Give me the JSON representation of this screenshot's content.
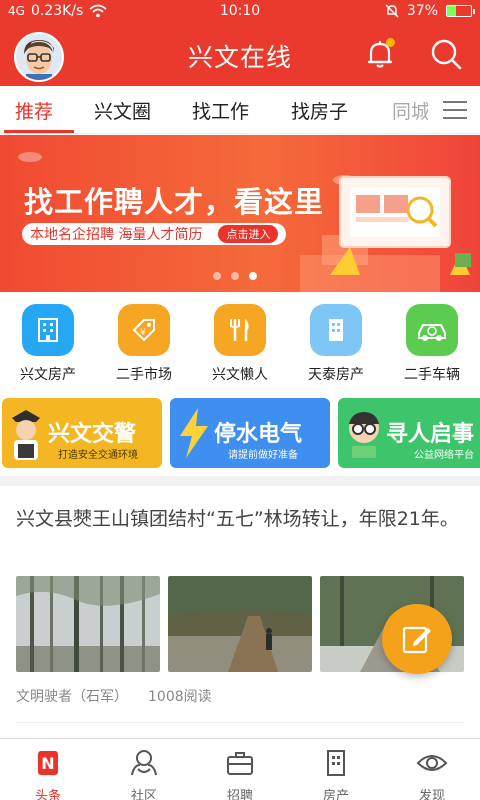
{
  "status": {
    "network": "4G",
    "speed": "0.23K/s",
    "time": "10:10",
    "battery": "37%",
    "battery_level": 0.37
  },
  "header": {
    "title": "兴文在线",
    "avatar_icon": "avatar-cartoon-glasses",
    "notification_icon": "bell-icon",
    "search_icon": "search-icon"
  },
  "tabs": [
    {
      "label": "推荐",
      "active": true
    },
    {
      "label": "兴文圈"
    },
    {
      "label": "找工作"
    },
    {
      "label": "找房子"
    },
    {
      "label": "同城"
    }
  ],
  "banner": {
    "headline": "找工作聘人才，看这里",
    "subtext": "本地名企招聘  海量人才简历",
    "cta": "点击进入",
    "slide_count": 3,
    "active_slide": 3
  },
  "quick_links": [
    {
      "label": "兴文房产",
      "icon": "building-icon",
      "color": "#25a7f3"
    },
    {
      "label": "二手市场",
      "icon": "price-tag-icon",
      "color": "#f6a623"
    },
    {
      "label": "兴文懒人",
      "icon": "fork-knife-icon",
      "color": "#f6a623"
    },
    {
      "label": "天泰房产",
      "icon": "building-icon",
      "color": "#7ec6f6"
    },
    {
      "label": "二手车辆",
      "icon": "car-icon",
      "color": "#5ccc50"
    }
  ],
  "promos": [
    {
      "title": "兴文交警",
      "subtitle": "打造安全交通环境",
      "color": "#f4b623"
    },
    {
      "title": "停水电气",
      "subtitle": "请提前做好准备",
      "color": "#3e8ff0"
    },
    {
      "title": "寻人启事",
      "subtitle": "公益网络平台",
      "color": "#3ec46a"
    }
  ],
  "article": {
    "title": "兴文县僰王山镇团结村“五七”林场转让，年限21年。",
    "author": "文明驶者（石军）",
    "reads": "1008阅读"
  },
  "fab_icon": "edit-icon",
  "bottom_nav": [
    {
      "label": "头条",
      "icon": "news-icon",
      "active": true
    },
    {
      "label": "社区",
      "icon": "community-icon"
    },
    {
      "label": "招聘",
      "icon": "briefcase-icon"
    },
    {
      "label": "房产",
      "icon": "building-icon"
    },
    {
      "label": "发现",
      "icon": "eye-icon"
    }
  ]
}
